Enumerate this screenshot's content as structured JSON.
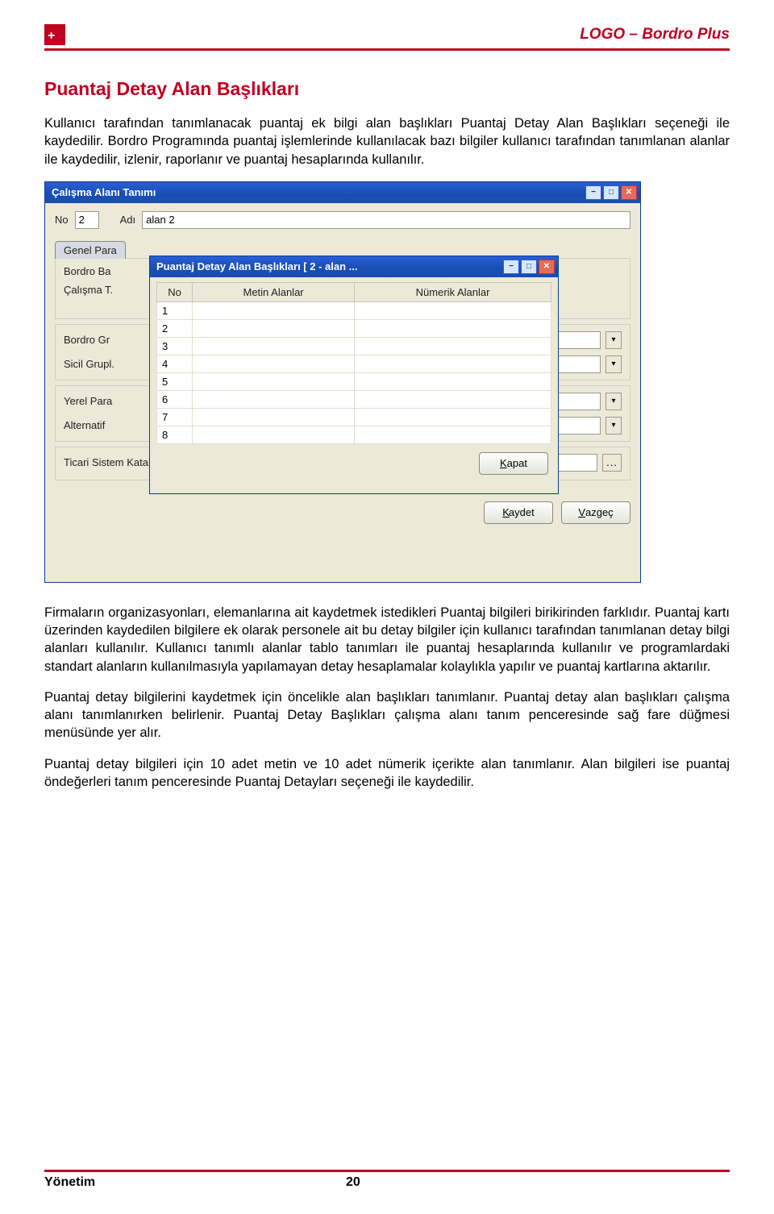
{
  "header": {
    "logo_glyph": "+",
    "product": "LOGO – Bordro Plus"
  },
  "section": {
    "title": "Puantaj Detay Alan Başlıkları",
    "para1": "Kullanıcı tarafından tanımlanacak puantaj ek bilgi alan başlıkları Puantaj Detay Alan Başlıkları seçeneği ile kaydedilir. Bordro Programında puantaj işlemlerinde kullanılacak bazı bilgiler kullanıcı tarafından tanımlanan alanlar ile kaydedilir, izlenir, raporlanır ve puantaj hesaplarında kullanılır.",
    "para2": "Firmaların organizasyonları, elemanlarına ait kaydetmek istedikleri Puantaj bilgileri birikirinden farklıdır. Puantaj kartı üzerinden kaydedilen bilgilere ek olarak personele ait bu detay bilgiler için kullanıcı tarafından tanımlanan detay bilgi alanları kullanılır. Kullanıcı tanımlı alanlar tablo tanımları ile puantaj hesaplarında kullanılır ve programlardaki standart alanların kullanılmasıyla yapılamayan detay hesaplamalar kolaylıkla yapılır ve puantaj kartlarına aktarılır.",
    "para3": "Puantaj detay bilgilerini kaydetmek için öncelikle alan başlıkları tanımlanır. Puantaj detay alan başlıkları çalışma alanı tanımlanırken belirlenir. Puantaj Detay Başlıkları çalışma alanı tanım penceresinde sağ fare düğmesi menüsünde yer alır.",
    "para4": "Puantaj detay bilgileri için 10 adet metin ve 10 adet nümerik içerikte alan tanımlanır. Alan bilgileri ise puantaj öndeğerleri tanım penceresinde Puantaj Detayları seçeneği ile kaydedilir."
  },
  "win_bg": {
    "title": "Çalışma Alanı Tanımı",
    "no_label": "No",
    "no_value": "2",
    "adi_label": "Adı",
    "adi_value": "alan 2",
    "tab": "Genel Para",
    "labels": {
      "bordro_ba": "Bordro Ba",
      "calisma_t": "Çalışma T.",
      "bordro_gr": "Bordro Gr",
      "sicil_grupl": "Sicil Grupl.",
      "yerel_para": "Yerel Para",
      "alternatif": "Alternatif",
      "ticari": "Ticari Sistem Kataloğu"
    },
    "buttons": {
      "kaydet": "Kaydet",
      "vazgec": "Vazgeç"
    }
  },
  "win_modal": {
    "title": "Puantaj Detay Alan Başlıkları [ 2 - alan ...",
    "columns": {
      "no": "No",
      "metin": "Metin Alanlar",
      "numerik": "Nümerik Alanlar"
    },
    "rows": [
      "1",
      "2",
      "3",
      "4",
      "5",
      "6",
      "7",
      "8"
    ],
    "close_label": "Kapat"
  },
  "footer": {
    "section": "Yönetim",
    "page": "20"
  }
}
